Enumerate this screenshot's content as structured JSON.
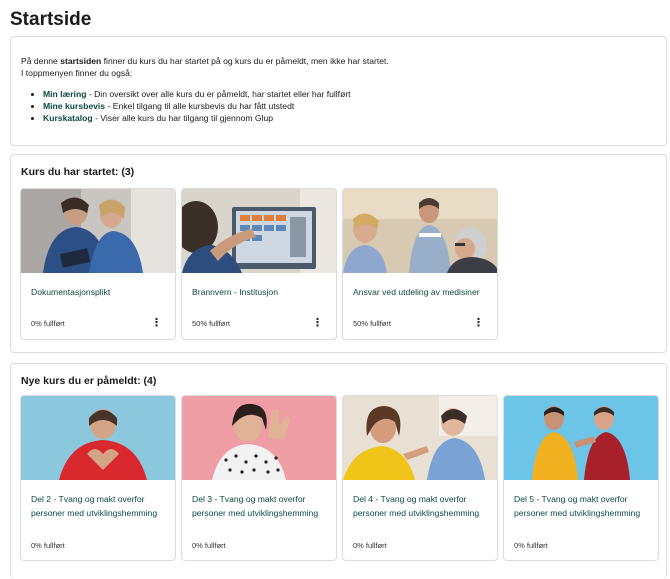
{
  "page": {
    "title": "Startside"
  },
  "intro": {
    "line1_pre": "På denne ",
    "line1_bold": "startsiden",
    "line1_post": " finner du kurs du har startet på og kurs du er påmeldt, men ikke har startet.",
    "line2": "I toppmenyen finner du også:",
    "items": [
      {
        "term": "Min læring",
        "desc": " - Din oversikt over alle kurs du er påmeldt, har startet eller har fullført"
      },
      {
        "term": "Mine kursbevis",
        "desc": " - Enkel tilgang til alle kursbevis du har fått utstedt"
      },
      {
        "term": "Kurskatalog",
        "desc": " - Viser alle kurs du har tilgang til gjennom Glup"
      }
    ]
  },
  "started": {
    "title": "Kurs du har startet: (3)",
    "courses": [
      {
        "title": "Dokumentasjonsplikt",
        "progress": "0% fullført",
        "menu_icon": "vertical-dots-icon"
      },
      {
        "title": "Brannvern - Institusjon",
        "progress": "50% fullført",
        "menu_icon": "vertical-dots-icon"
      },
      {
        "title": "Ansvar ved utdeling av medisiner",
        "progress": "50% fullført",
        "menu_icon": "vertical-dots-icon"
      }
    ]
  },
  "enrolled": {
    "title": "Nye kurs du er påmeldt: (4)",
    "courses": [
      {
        "title": "Del 2 - Tvang og makt overfor personer med utviklingshemming",
        "progress": "0% fullført"
      },
      {
        "title": "Del 3 - Tvang og makt overfor personer med utviklingshemming",
        "progress": "0% fullført"
      },
      {
        "title": "Del 4 - Tvang og makt overfor personer med utviklingshemming",
        "progress": "0% fullført"
      },
      {
        "title": "Del 5 - Tvang og makt overfor personer med utviklingshemming",
        "progress": "0% fullført"
      }
    ]
  },
  "colors": {
    "link": "#0b4a3e",
    "border": "#dcdcdc",
    "text": "#1a1a1a"
  }
}
